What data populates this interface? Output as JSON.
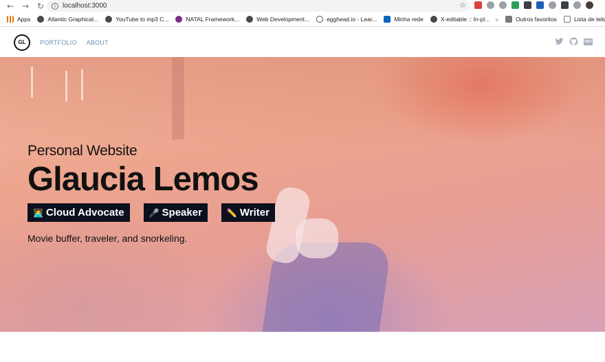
{
  "browser": {
    "url": "localhost:3000",
    "bookmarks": [
      {
        "label": "Apps",
        "icon": "apps-grid-icon"
      },
      {
        "label": "Atlantic Graphical...",
        "icon": "globe-icon"
      },
      {
        "label": "YouTube to mp3 C...",
        "icon": "globe-icon"
      },
      {
        "label": "NATAL Framework...",
        "icon": "natal-icon"
      },
      {
        "label": "Web Development...",
        "icon": "globe-icon"
      },
      {
        "label": "egghead.io - Lear...",
        "icon": "egghead-icon"
      },
      {
        "label": "Minha rede",
        "icon": "linkedin-icon"
      },
      {
        "label": "X-editable :: In-pl...",
        "icon": "globe-icon"
      }
    ],
    "overflow_label": "»",
    "other_bookmarks": "Outros favoritos",
    "reading_list": "Lista de leitura"
  },
  "site": {
    "logo_text": "GL",
    "nav": [
      "PORTFOLIO",
      "ABOUT"
    ],
    "social": [
      "twitter-icon",
      "github-icon",
      "dev-icon"
    ],
    "dev_label": "DEV"
  },
  "hero": {
    "subtitle": "Personal Website",
    "name": "Glaucia Lemos",
    "badges": [
      {
        "emoji": "👩‍💻",
        "label": "Cloud Advocate"
      },
      {
        "emoji": "🎤",
        "label": "Speaker"
      },
      {
        "emoji": "✏️",
        "label": "Writer"
      }
    ],
    "tagline": "Movie buffer, traveler, and snorkeling."
  }
}
